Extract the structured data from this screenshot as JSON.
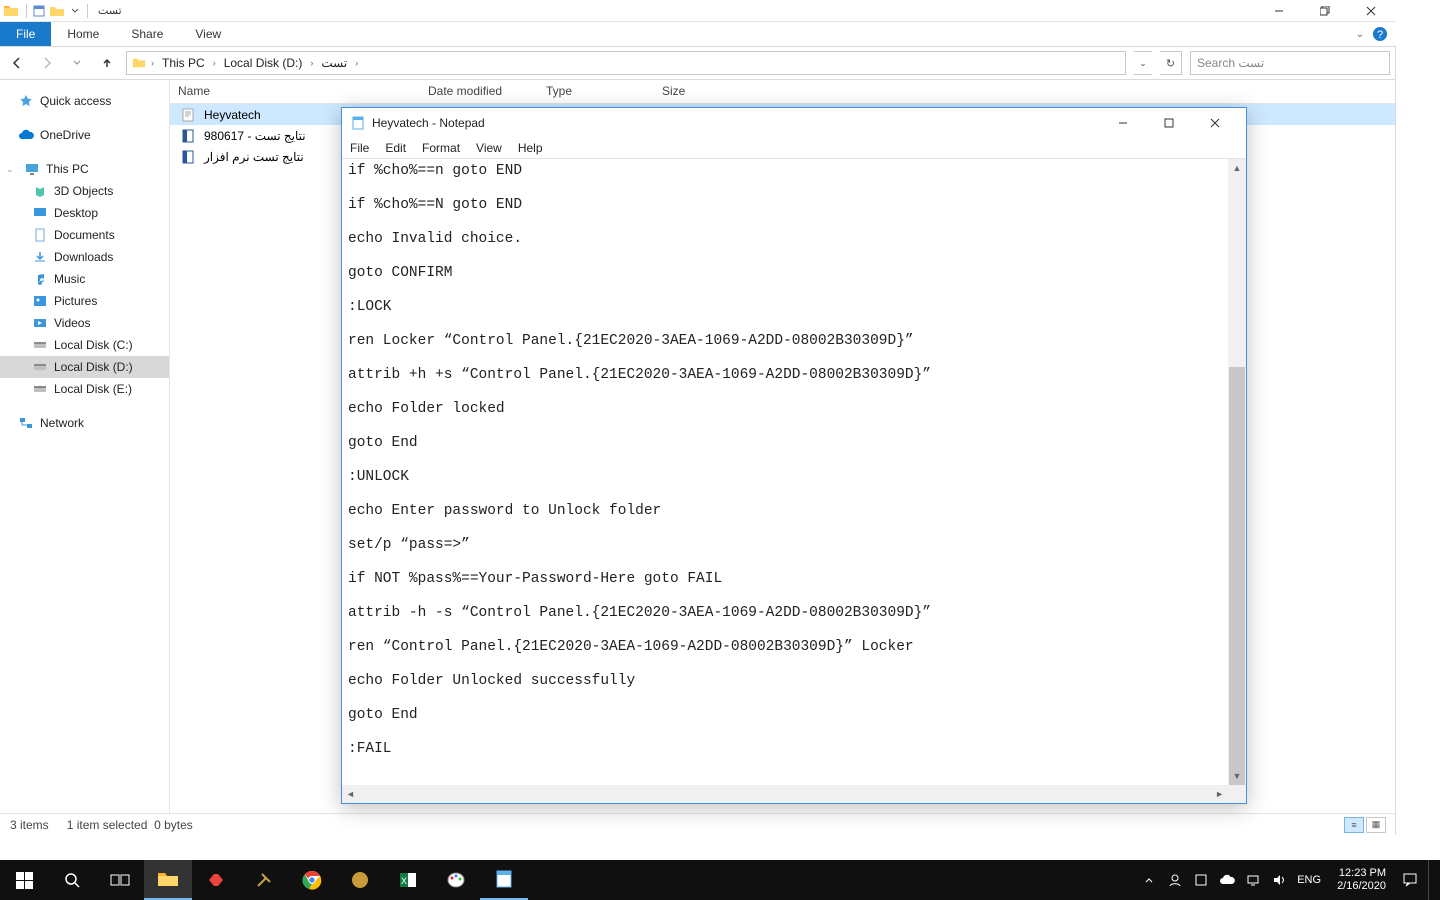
{
  "explorer": {
    "title": "تست",
    "ribbon": {
      "file": "File",
      "tabs": [
        "Home",
        "Share",
        "View"
      ]
    },
    "breadcrumbs": [
      "This PC",
      "Local Disk (D:)",
      "تست"
    ],
    "search_placeholder": "Search تست",
    "columns": [
      "Name",
      "Date modified",
      "Type",
      "Size"
    ],
    "nav": {
      "quick_access": "Quick access",
      "onedrive": "OneDrive",
      "this_pc": "This PC",
      "children": [
        "3D Objects",
        "Desktop",
        "Documents",
        "Downloads",
        "Music",
        "Pictures",
        "Videos",
        "Local Disk (C:)",
        "Local Disk (D:)",
        "Local Disk (E:)"
      ],
      "network": "Network"
    },
    "files": [
      {
        "name": "Heyvatech",
        "icon": "txt",
        "selected": true
      },
      {
        "name": "نتایج تست - 980617",
        "icon": "docx",
        "selected": false
      },
      {
        "name": "نتایج تست نرم افزار",
        "icon": "docx",
        "selected": false
      }
    ],
    "status": {
      "count": "3 items",
      "sel": "1 item selected",
      "size": "0 bytes"
    }
  },
  "notepad": {
    "title": "Heyvatech - Notepad",
    "menu": [
      "File",
      "Edit",
      "Format",
      "View",
      "Help"
    ],
    "content": "if %cho%==n goto END\n\nif %cho%==N goto END\n\necho Invalid choice.\n\ngoto CONFIRM\n\n:LOCK\n\nren Locker “Control Panel.{21EC2020-3AEA-1069-A2DD-08002B30309D}”\n\nattrib +h +s “Control Panel.{21EC2020-3AEA-1069-A2DD-08002B30309D}”\n\necho Folder locked\n\ngoto End\n\n:UNLOCK\n\necho Enter password to Unlock folder\n\nset/p “pass=>”\n\nif NOT %pass%==Your-Password-Here goto FAIL\n\nattrib -h -s “Control Panel.{21EC2020-3AEA-1069-A2DD-08002B30309D}”\n\nren “Control Panel.{21EC2020-3AEA-1069-A2DD-08002B30309D}” Locker\n\necho Folder Unlocked successfully\n\ngoto End\n\n:FAIL"
  },
  "taskbar": {
    "lang": "ENG",
    "time": "12:23 PM",
    "date": "2/16/2020"
  }
}
